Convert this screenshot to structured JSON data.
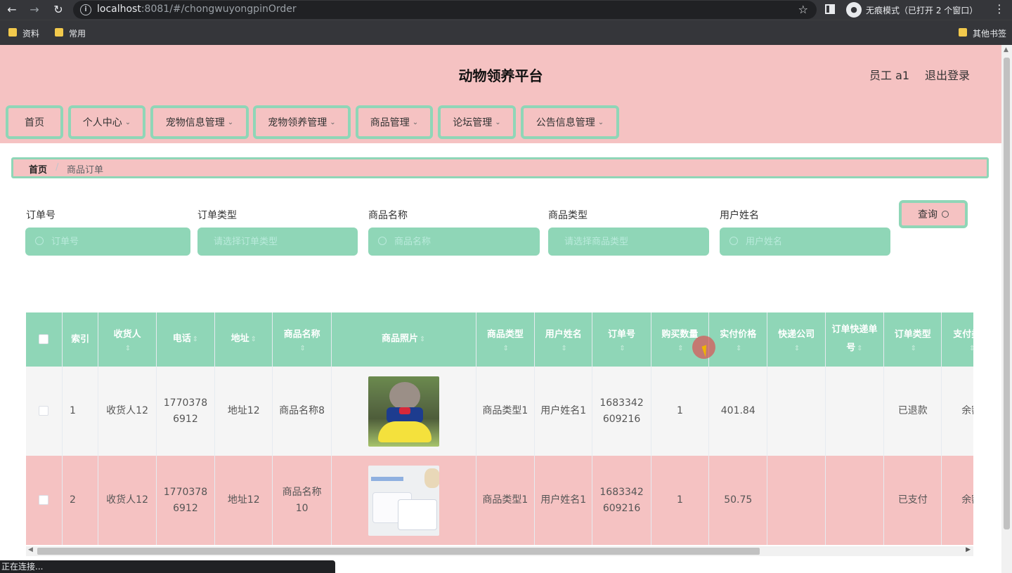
{
  "browser": {
    "url_host": "localhost",
    "url_rest": ":8081/#/chongwuyongpinOrder",
    "incognito_text": "无痕模式（已打开 2 个窗口）",
    "bookmarks": [
      "资料",
      "常用"
    ],
    "other_bookmarks": "其他书签",
    "status_text": "正在连接..."
  },
  "header": {
    "title": "动物领养平台",
    "user": "员工 a1",
    "logout": "退出登录"
  },
  "menu": [
    {
      "label": "首页",
      "dropdown": false
    },
    {
      "label": "个人中心",
      "dropdown": true
    },
    {
      "label": "宠物信息管理",
      "dropdown": true
    },
    {
      "label": "宠物领养管理",
      "dropdown": true
    },
    {
      "label": "商品管理",
      "dropdown": true
    },
    {
      "label": "论坛管理",
      "dropdown": true
    },
    {
      "label": "公告信息管理",
      "dropdown": true
    }
  ],
  "breadcrumb": {
    "home": "首页",
    "current": "商品订单"
  },
  "search": {
    "fields": [
      {
        "label": "订单号",
        "placeholder": "订单号"
      },
      {
        "label": "订单类型",
        "placeholder": "请选择订单类型"
      },
      {
        "label": "商品名称",
        "placeholder": "商品名称"
      },
      {
        "label": "商品类型",
        "placeholder": "请选择商品类型"
      },
      {
        "label": "用户姓名",
        "placeholder": "用户姓名"
      }
    ],
    "query_button": "查询"
  },
  "table": {
    "headers": [
      "索引",
      "收货人",
      "电话",
      "地址",
      "商品名称",
      "商品照片",
      "商品类型",
      "用户姓名",
      "订单号",
      "购买数量",
      "实付价格",
      "快递公司",
      "订单快递单号",
      "订单类型",
      "支付类型"
    ],
    "rows": [
      {
        "index": "1",
        "receiver": "收货人12",
        "phone": "17703786912",
        "address": "地址12",
        "product_name": "商品名称8",
        "product_type": "商品类型1",
        "user_name": "用户姓名1",
        "order_no": "1683342609216",
        "quantity": "1",
        "price": "401.84",
        "courier": "",
        "tracking_no": "",
        "order_type": "已退款",
        "pay_type": "余额"
      },
      {
        "index": "2",
        "receiver": "收货人12",
        "phone": "17703786912",
        "address": "地址12",
        "product_name": "商品名称10",
        "product_type": "商品类型1",
        "user_name": "用户姓名1",
        "order_no": "1683342609216",
        "quantity": "1",
        "price": "50.75",
        "courier": "",
        "tracking_no": "",
        "order_type": "已支付",
        "pay_type": "余额"
      }
    ]
  },
  "colors": {
    "pink": "#f5c2c2",
    "mint": "#8fd6b7",
    "row_gray": "#f5f5f5"
  }
}
